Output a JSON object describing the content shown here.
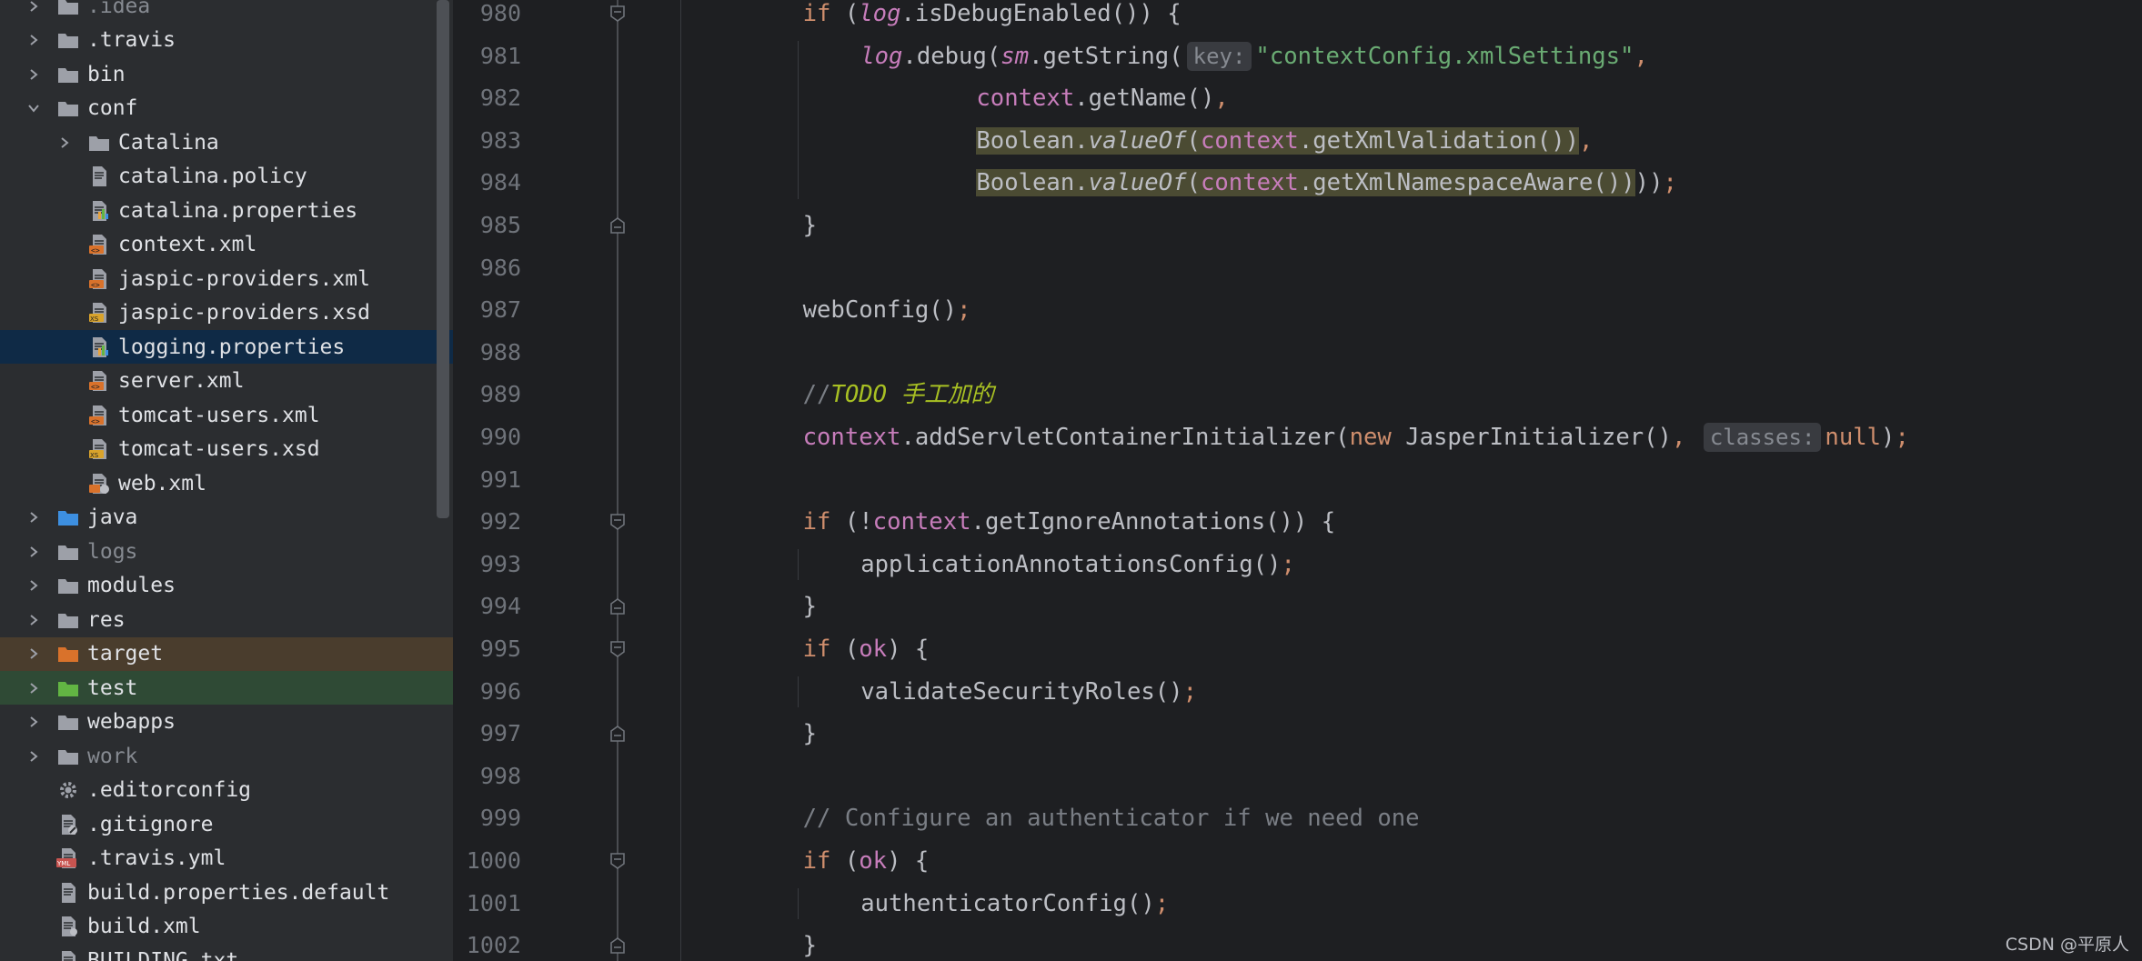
{
  "project_tree": {
    "items": [
      {
        "label": ".idea",
        "kind": "folder",
        "expand": "collapsed",
        "depth": 0,
        "dim": true
      },
      {
        "label": ".travis",
        "kind": "folder",
        "expand": "collapsed",
        "depth": 0
      },
      {
        "label": "bin",
        "kind": "folder",
        "expand": "collapsed",
        "depth": 0
      },
      {
        "label": "conf",
        "kind": "folder-config",
        "expand": "expanded",
        "depth": 0
      },
      {
        "label": "Catalina",
        "kind": "folder",
        "expand": "collapsed",
        "depth": 1
      },
      {
        "label": "catalina.policy",
        "kind": "file-text",
        "depth": 1
      },
      {
        "label": "catalina.properties",
        "kind": "file-properties",
        "depth": 1
      },
      {
        "label": "context.xml",
        "kind": "file-xml",
        "depth": 1
      },
      {
        "label": "jaspic-providers.xml",
        "kind": "file-xml",
        "depth": 1
      },
      {
        "label": "jaspic-providers.xsd",
        "kind": "file-xsd",
        "depth": 1
      },
      {
        "label": "logging.properties",
        "kind": "file-properties",
        "depth": 1,
        "selected": true
      },
      {
        "label": "server.xml",
        "kind": "file-xml",
        "depth": 1
      },
      {
        "label": "tomcat-users.xml",
        "kind": "file-xml",
        "depth": 1
      },
      {
        "label": "tomcat-users.xsd",
        "kind": "file-xsd",
        "depth": 1
      },
      {
        "label": "web.xml",
        "kind": "file-webxml",
        "depth": 1
      },
      {
        "label": "java",
        "kind": "folder-source",
        "expand": "collapsed",
        "depth": 0
      },
      {
        "label": "logs",
        "kind": "folder",
        "expand": "collapsed",
        "depth": 0,
        "dim": true
      },
      {
        "label": "modules",
        "kind": "folder",
        "expand": "collapsed",
        "depth": 0
      },
      {
        "label": "res",
        "kind": "folder",
        "expand": "collapsed",
        "depth": 0
      },
      {
        "label": "target",
        "kind": "folder-excluded",
        "expand": "collapsed",
        "depth": 0,
        "highlight": "target"
      },
      {
        "label": "test",
        "kind": "folder-test",
        "expand": "collapsed",
        "depth": 0,
        "highlight": "test"
      },
      {
        "label": "webapps",
        "kind": "folder",
        "expand": "collapsed",
        "depth": 0
      },
      {
        "label": "work",
        "kind": "folder",
        "expand": "collapsed",
        "depth": 0,
        "dim": true
      },
      {
        "label": ".editorconfig",
        "kind": "file-gear",
        "depth": 0
      },
      {
        "label": ".gitignore",
        "kind": "file-ignore",
        "depth": 0
      },
      {
        "label": ".travis.yml",
        "kind": "file-yml",
        "depth": 0
      },
      {
        "label": "build.properties.default",
        "kind": "file-text",
        "depth": 0
      },
      {
        "label": "build.xml",
        "kind": "file-ant",
        "depth": 0
      },
      {
        "label": "BUILDING.txt",
        "kind": "file-text",
        "depth": 0
      }
    ]
  },
  "editor": {
    "lines": [
      {
        "n": "980",
        "fold": "open",
        "indent": 1,
        "tokens": [
          [
            "kw",
            "if "
          ],
          [
            "p",
            "("
          ],
          [
            "fldi",
            "log"
          ],
          [
            "p",
            ".isDebugEnabled()) {"
          ]
        ]
      },
      {
        "n": "981",
        "indent": 2,
        "tokens": [
          [
            "fldi",
            "log"
          ],
          [
            "p",
            ".debug("
          ],
          [
            "fldi",
            "sm"
          ],
          [
            "p",
            ".getString("
          ],
          [
            "hint",
            "key:"
          ],
          [
            "str",
            "\"contextConfig.xmlSettings\""
          ],
          [
            "kw",
            ","
          ]
        ]
      },
      {
        "n": "982",
        "indent": 4,
        "tokens": [
          [
            "fld",
            "context"
          ],
          [
            "p",
            ".getName()"
          ],
          [
            "kw",
            ","
          ]
        ]
      },
      {
        "n": "983",
        "indent": 4,
        "tokens": [
          [
            "mark-p",
            "Boolean."
          ],
          [
            "mark-mi",
            "valueOf"
          ],
          [
            "mark-p",
            "("
          ],
          [
            "mark-fld",
            "context"
          ],
          [
            "mark-p",
            ".getXmlValidation())"
          ],
          [
            "kw",
            ","
          ]
        ]
      },
      {
        "n": "984",
        "indent": 4,
        "tokens": [
          [
            "mark-p",
            "Boolean."
          ],
          [
            "mark-mi",
            "valueOf"
          ],
          [
            "mark-p",
            "("
          ],
          [
            "mark-fld",
            "context"
          ],
          [
            "mark-p",
            ".getXmlNamespaceAware())"
          ],
          [
            "p",
            "))"
          ],
          [
            "kw",
            ";"
          ]
        ]
      },
      {
        "n": "985",
        "fold": "close",
        "indent": 1,
        "tokens": [
          [
            "p",
            "}"
          ]
        ]
      },
      {
        "n": "986",
        "indent": 0,
        "tokens": []
      },
      {
        "n": "987",
        "indent": 1,
        "tokens": [
          [
            "p",
            "webConfig()"
          ],
          [
            "kw",
            ";"
          ]
        ]
      },
      {
        "n": "988",
        "indent": 0,
        "tokens": []
      },
      {
        "n": "989",
        "indent": 1,
        "tokens": [
          [
            "cmt",
            "//"
          ],
          [
            "todo",
            "TODO 手工加的"
          ]
        ]
      },
      {
        "n": "990",
        "indent": 1,
        "tokens": [
          [
            "fld",
            "context"
          ],
          [
            "p",
            ".addServletContainerInitializer("
          ],
          [
            "kw",
            "new "
          ],
          [
            "p",
            "JasperInitializer()"
          ],
          [
            "kw",
            ", "
          ],
          [
            "hint",
            "classes:"
          ],
          [
            "kw",
            "null"
          ],
          [
            "p",
            ")"
          ],
          [
            "kw",
            ";"
          ]
        ]
      },
      {
        "n": "991",
        "indent": 0,
        "tokens": []
      },
      {
        "n": "992",
        "fold": "open",
        "indent": 1,
        "tokens": [
          [
            "kw",
            "if "
          ],
          [
            "p",
            "(!"
          ],
          [
            "fld",
            "context"
          ],
          [
            "p",
            ".getIgnoreAnnotations()) {"
          ]
        ]
      },
      {
        "n": "993",
        "indent": 2,
        "tokens": [
          [
            "p",
            "applicationAnnotationsConfig()"
          ],
          [
            "kw",
            ";"
          ]
        ]
      },
      {
        "n": "994",
        "fold": "close",
        "indent": 1,
        "tokens": [
          [
            "p",
            "}"
          ]
        ]
      },
      {
        "n": "995",
        "fold": "open",
        "indent": 1,
        "tokens": [
          [
            "kw",
            "if "
          ],
          [
            "p",
            "("
          ],
          [
            "fld",
            "ok"
          ],
          [
            "p",
            ") {"
          ]
        ]
      },
      {
        "n": "996",
        "indent": 2,
        "tokens": [
          [
            "p",
            "validateSecurityRoles()"
          ],
          [
            "kw",
            ";"
          ]
        ]
      },
      {
        "n": "997",
        "fold": "close",
        "indent": 1,
        "tokens": [
          [
            "p",
            "}"
          ]
        ]
      },
      {
        "n": "998",
        "indent": 0,
        "tokens": []
      },
      {
        "n": "999",
        "indent": 1,
        "tokens": [
          [
            "cmt",
            "// Configure an authenticator if we need one"
          ]
        ]
      },
      {
        "n": "1000",
        "fold": "open",
        "indent": 1,
        "tokens": [
          [
            "kw",
            "if "
          ],
          [
            "p",
            "("
          ],
          [
            "fld",
            "ok"
          ],
          [
            "p",
            ") {"
          ]
        ]
      },
      {
        "n": "1001",
        "indent": 2,
        "tokens": [
          [
            "p",
            "authenticatorConfig()"
          ],
          [
            "kw",
            ";"
          ]
        ]
      },
      {
        "n": "1002",
        "fold": "close",
        "indent": 1,
        "tokens": [
          [
            "p",
            "}"
          ]
        ]
      }
    ]
  },
  "watermark": "CSDN @平原人",
  "colors": {
    "tree_bg": "#2b2d30",
    "editor_bg": "#1e1f22",
    "selected_row": "#0f2a46",
    "keyword": "#cf8e6d",
    "field": "#c77dbb",
    "string": "#6aab73",
    "comment": "#7a7e85",
    "todo": "#a8c023"
  }
}
